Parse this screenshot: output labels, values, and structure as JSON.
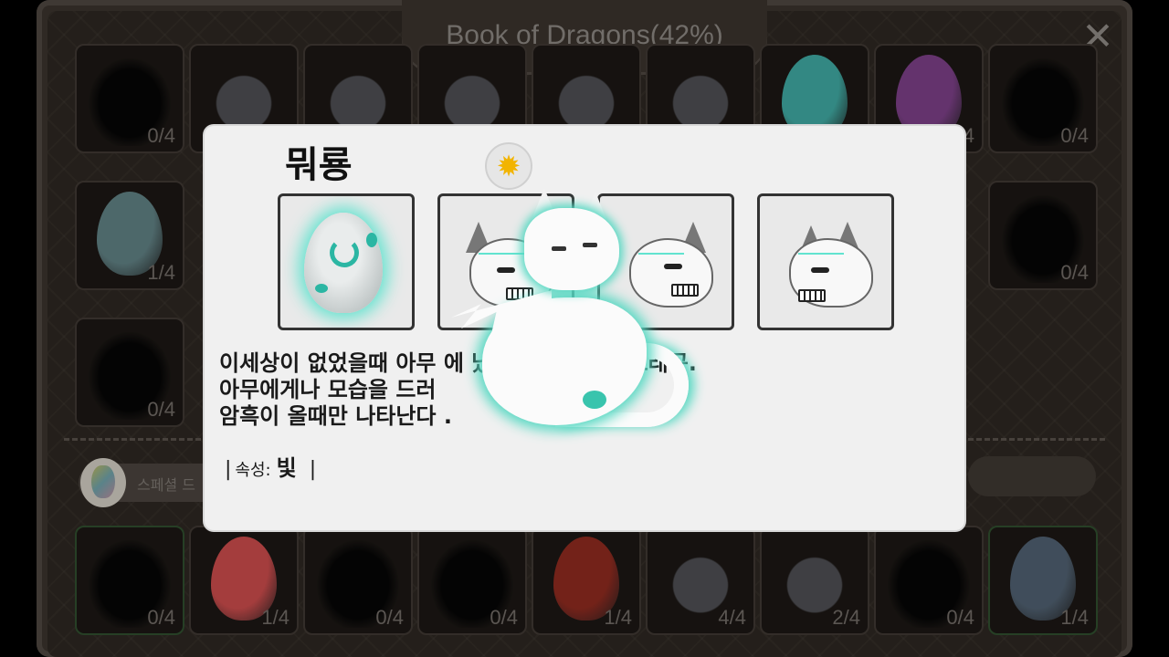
{
  "book": {
    "title": "Book of Dragons(42%)",
    "close_icon": "✕"
  },
  "grid_top": [
    {
      "count": "0/4",
      "kind": "silhouette"
    },
    {
      "count": "",
      "kind": "creature"
    },
    {
      "count": "",
      "kind": "creature"
    },
    {
      "count": "",
      "kind": "creature"
    },
    {
      "count": "",
      "kind": "creature"
    },
    {
      "count": "",
      "kind": "creature"
    },
    {
      "count": "",
      "kind": "egg",
      "color": "#3fa7a0"
    },
    {
      "count": "4",
      "kind": "egg",
      "color": "#7b3f86"
    },
    {
      "count": "0/4",
      "kind": "silhouette"
    }
  ],
  "grid_mid": [
    {
      "count": "1/4",
      "kind": "egg",
      "color": "#5f7f82"
    },
    {
      "count": "0/4",
      "kind": "silhouette"
    }
  ],
  "grid_mid2": [
    {
      "count": "0/4",
      "kind": "silhouette"
    }
  ],
  "special": {
    "label": "스페셜 드"
  },
  "grid_bottom": [
    {
      "count": "0/4",
      "kind": "silhouette"
    },
    {
      "count": "1/4",
      "kind": "egg",
      "color": "#c94b4b"
    },
    {
      "count": "0/4",
      "kind": "silhouette"
    },
    {
      "count": "0/4",
      "kind": "silhouette"
    },
    {
      "count": "1/4",
      "kind": "egg",
      "color": "#8d2a1f"
    },
    {
      "count": "4/4",
      "kind": "creature"
    },
    {
      "count": "2/4",
      "kind": "creature"
    },
    {
      "count": "0/4",
      "kind": "silhouette"
    },
    {
      "count": "1/4",
      "kind": "egg",
      "color": "#4f5f6f"
    }
  ],
  "dialog": {
    "name": "뭐룡",
    "attribute_icon": "sun-icon",
    "description_lines": [
      "이세상이 없었을때 아무                                   에  났다고 전해지는 드래곤.",
      "아무에게나 모습을 드러",
      "암흑이 올때만 나타난다                     ."
    ],
    "attribute_label": "속성:",
    "attribute_value": "빛",
    "stage_count": 4
  },
  "colors": {
    "glow": "#55d8c2",
    "panel": "#f0f0f0",
    "frame": "#3a332d"
  }
}
